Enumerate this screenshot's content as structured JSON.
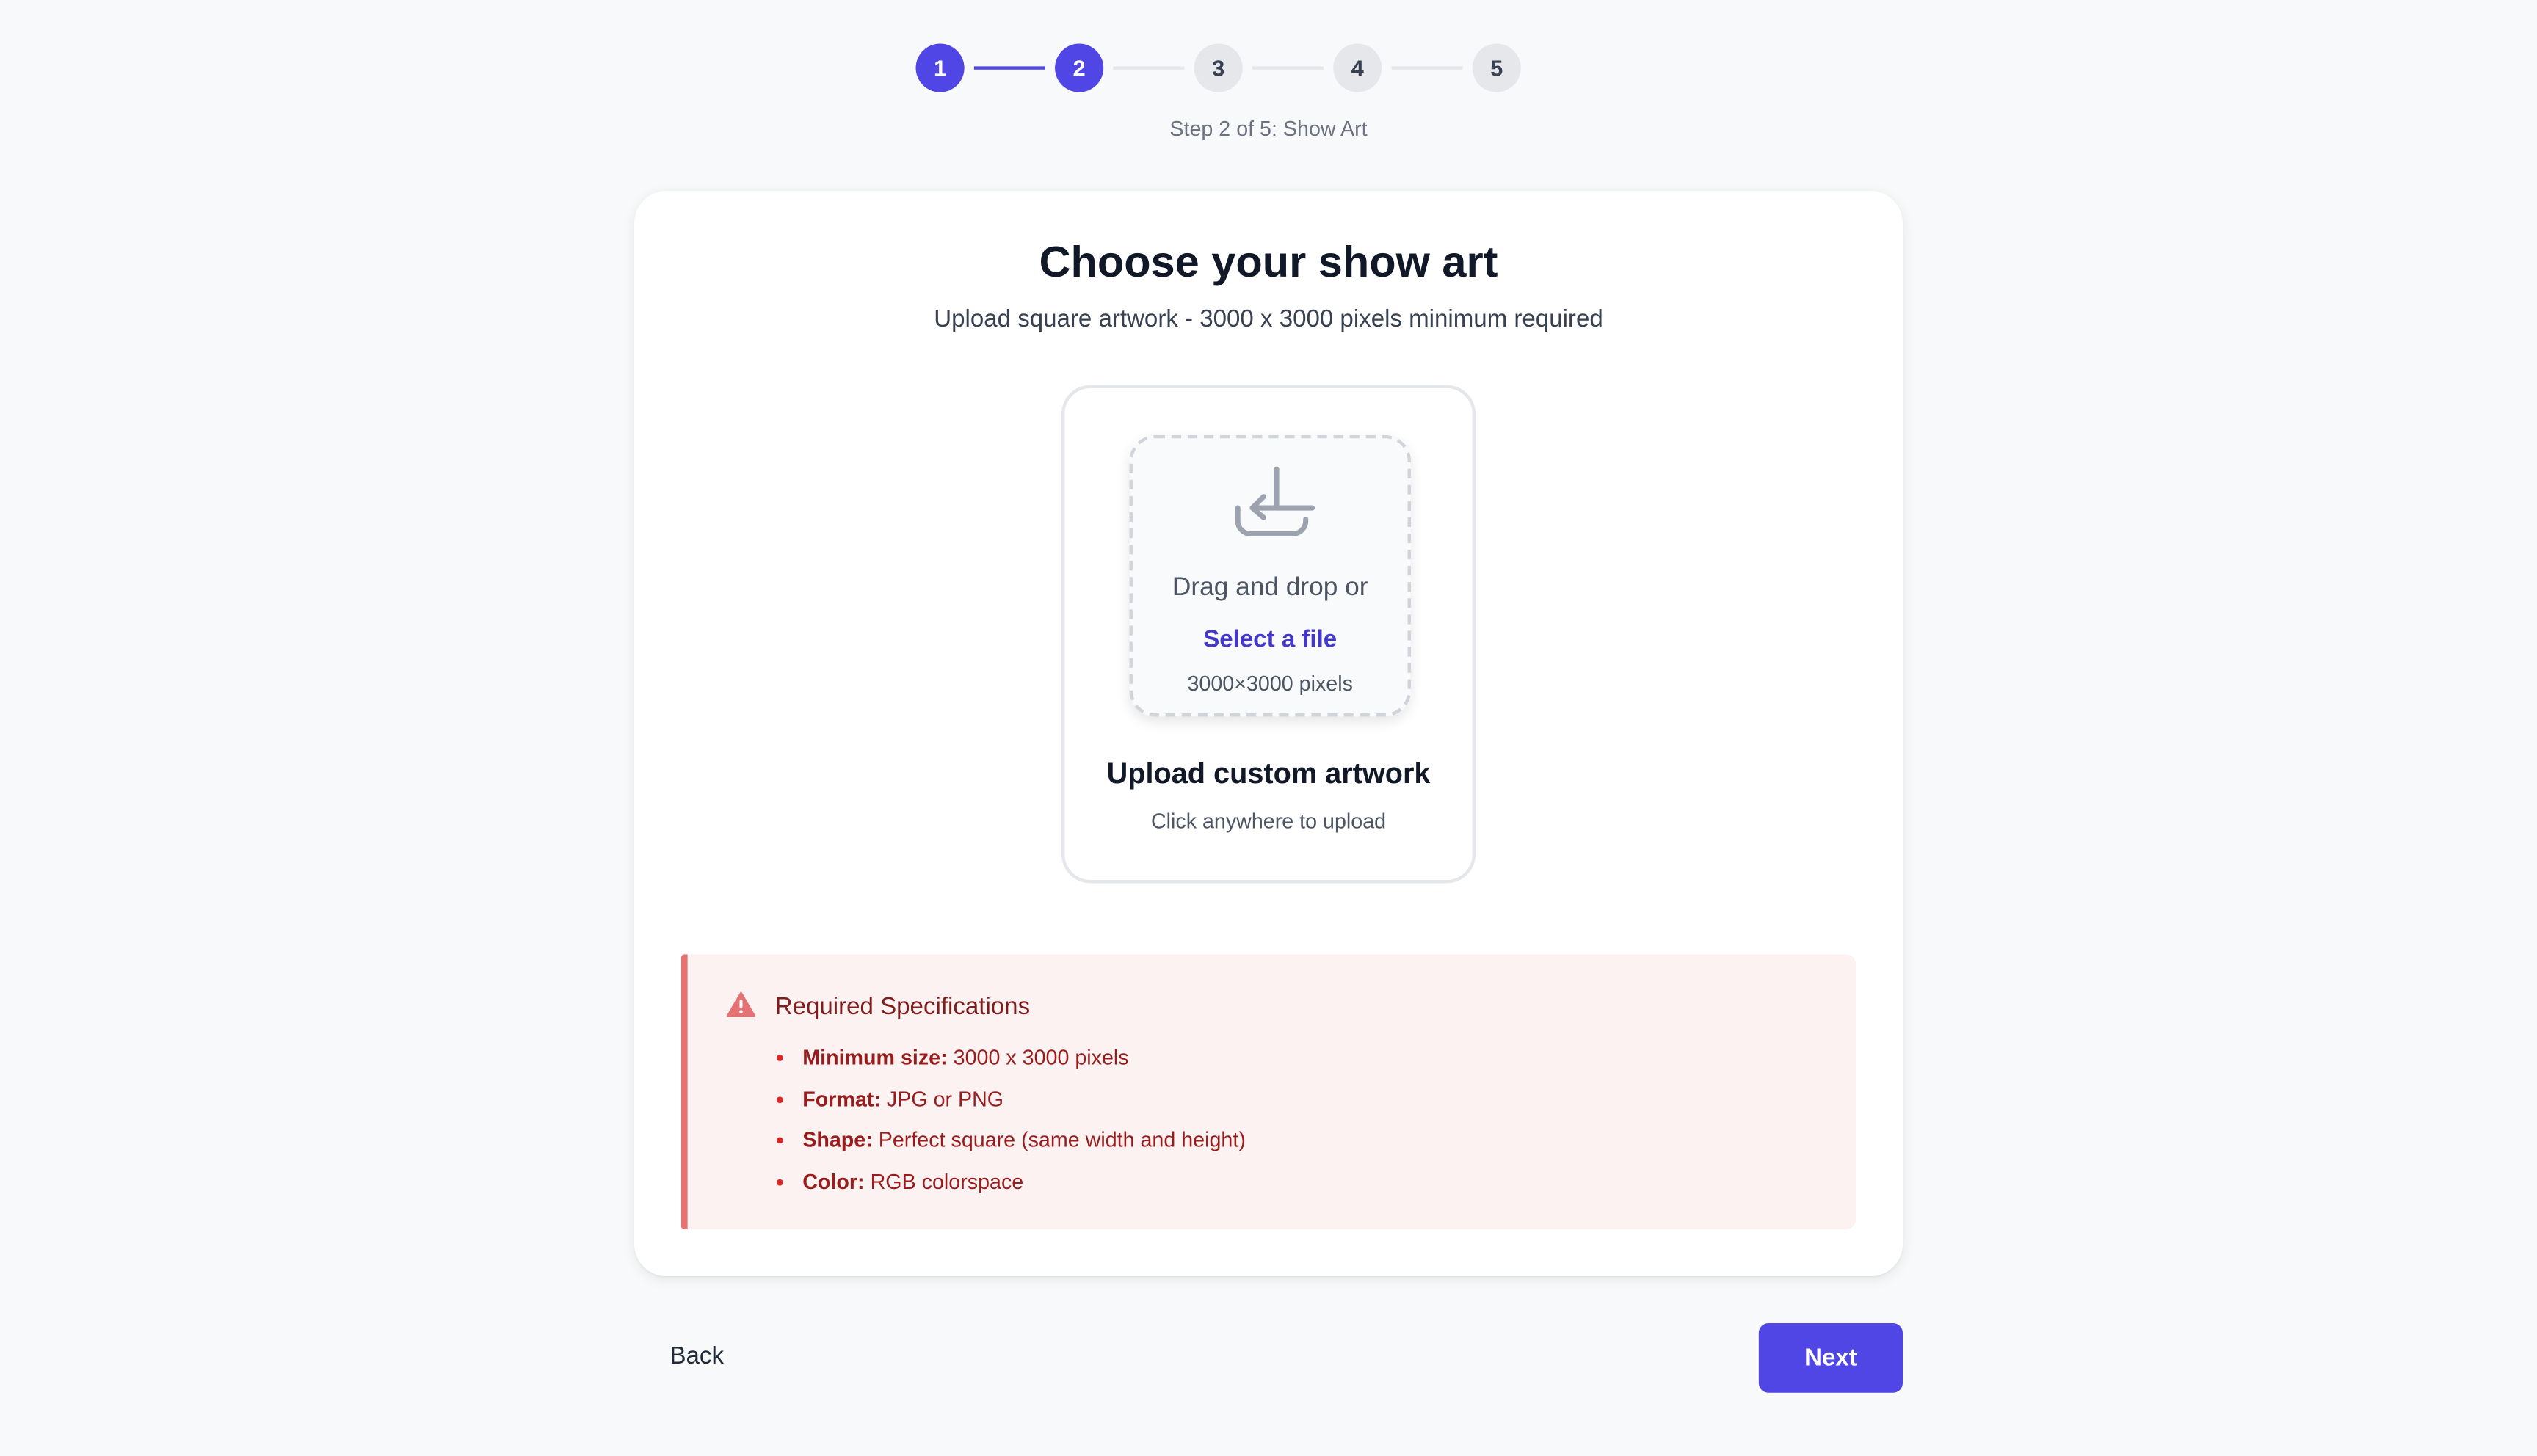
{
  "colors": {
    "accent": "#4f46e5",
    "step_inactive": "#e5e7eb",
    "warning_bg": "#fdf2f2",
    "warning_border": "#e57373",
    "warning_text": "#991b1b"
  },
  "stepper": {
    "steps": [
      {
        "label": "1",
        "state": "completed"
      },
      {
        "label": "2",
        "state": "current"
      },
      {
        "label": "3",
        "state": "upcoming"
      },
      {
        "label": "4",
        "state": "upcoming"
      },
      {
        "label": "5",
        "state": "upcoming"
      }
    ],
    "caption": "Step 2 of 5: Show Art"
  },
  "card": {
    "title": "Choose your show art",
    "subtitle": "Upload square artwork - 3000 x 3000 pixels minimum required",
    "upload": {
      "icon": "upload-tray-icon",
      "drag_text": "Drag and drop or",
      "select_link": "Select a file",
      "dimensions": "3000×3000 pixels",
      "title": "Upload custom artwork",
      "hint": "Click anywhere to upload"
    },
    "specs": {
      "icon": "warning-triangle-icon",
      "title": "Required Specifications",
      "items": [
        {
          "label": "Minimum size:",
          "value": "3000 x 3000 pixels"
        },
        {
          "label": "Format:",
          "value": "JPG or PNG"
        },
        {
          "label": "Shape:",
          "value": "Perfect square (same width and height)"
        },
        {
          "label": "Color:",
          "value": "RGB colorspace"
        }
      ]
    }
  },
  "footer": {
    "back_label": "Back",
    "next_label": "Next"
  }
}
